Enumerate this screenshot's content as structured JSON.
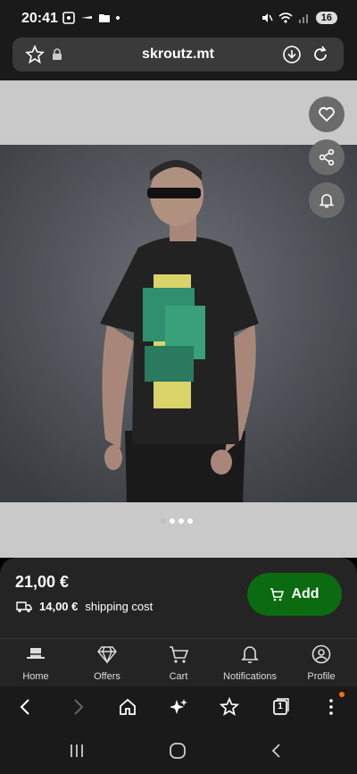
{
  "status": {
    "time": "20:41",
    "battery": "16"
  },
  "browser": {
    "url": "skroutz.mt"
  },
  "product": {
    "price": "21,00 €",
    "shipping_amount": "14,00 €",
    "shipping_label": "shipping cost",
    "add_label": "Add",
    "image_dots": 4,
    "active_dot": 0
  },
  "site_nav": [
    {
      "label": "Home",
      "icon": "hat-icon"
    },
    {
      "label": "Offers",
      "icon": "diamond-icon"
    },
    {
      "label": "Cart",
      "icon": "cart-icon"
    },
    {
      "label": "Notifications",
      "icon": "bell-icon"
    },
    {
      "label": "Profile",
      "icon": "profile-icon"
    }
  ],
  "browser_toolbar": {
    "tabs_count": "1"
  }
}
